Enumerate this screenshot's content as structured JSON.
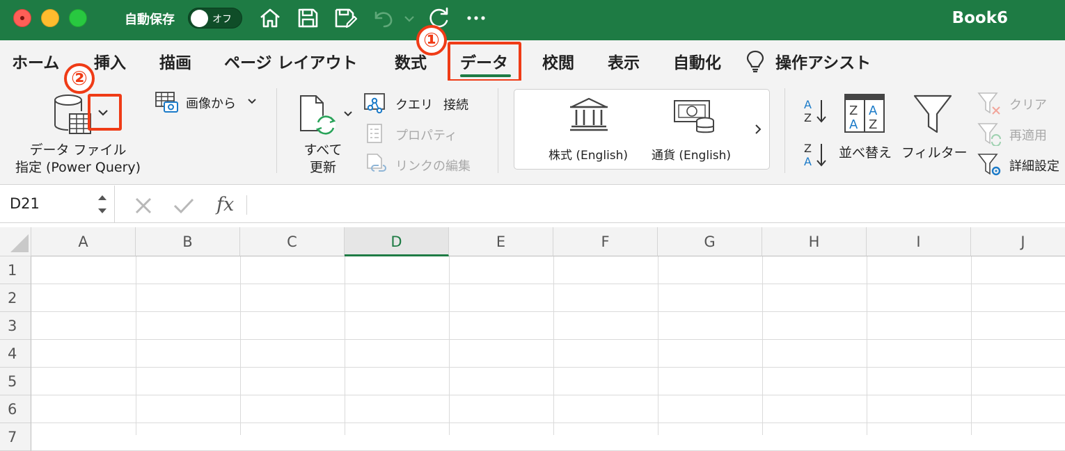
{
  "titlebar": {
    "autosave_label": "自動保存",
    "toggle_state": "オフ",
    "doc_title": "Book6"
  },
  "tabs": [
    {
      "label": "ホーム"
    },
    {
      "label": "挿入"
    },
    {
      "label": "描画"
    },
    {
      "label": "ページ レイアウト"
    },
    {
      "label": "数式"
    },
    {
      "label": "データ",
      "active": true
    },
    {
      "label": "校閲"
    },
    {
      "label": "表示"
    },
    {
      "label": "自動化"
    },
    {
      "label": "操作アシスト"
    }
  ],
  "annotations": {
    "step1": "①",
    "step2": "②",
    "highlight_color": "#ef3b16"
  },
  "ribbon": {
    "data_file_line1": "データ ファイル",
    "data_file_line2": "指定 (Power Query)",
    "from_image": "画像から",
    "refresh_line1": "すべて",
    "refresh_line2": "更新",
    "queries": "クエリ",
    "connections": "接続",
    "properties": "プロパティ",
    "edit_links": "リンクの編集",
    "stocks": "株式 (English)",
    "currencies": "通貨 (English)",
    "sort": "並べ替え",
    "filter": "フィルター",
    "clear": "クリア",
    "reapply": "再適用",
    "advanced": "詳細設定"
  },
  "formula_bar": {
    "name_box": "D21",
    "fx": "fx",
    "formula": ""
  },
  "grid": {
    "columns": [
      "A",
      "B",
      "C",
      "D",
      "E",
      "F",
      "G",
      "H",
      "I",
      "J"
    ],
    "active_column": "D",
    "rows": [
      "1",
      "2",
      "3",
      "4",
      "5",
      "6",
      "7"
    ]
  },
  "colors": {
    "brand_green": "#1e7b44",
    "ribbon_bg": "#f3f3f3"
  }
}
